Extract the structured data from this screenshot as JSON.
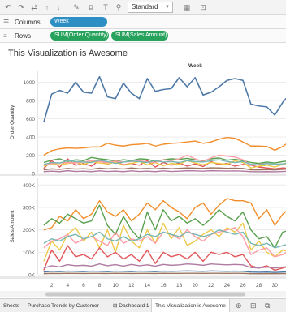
{
  "toolbar": {
    "icons": [
      "undo-icon",
      "redo-icon",
      "swap-icon",
      "sort-ascending-icon",
      "sort-descending-icon",
      "highlight-icon",
      "clip-icon",
      "label-icon",
      "pin-icon"
    ],
    "fit_value": "Standard",
    "view_icons": [
      "show-me-icon",
      "presentation-icon"
    ]
  },
  "shelves": {
    "columns": {
      "label": "Columns",
      "pills": [
        "Week"
      ]
    },
    "rows": {
      "label": "Rows",
      "pills": [
        "SUM(Order Quantity)",
        "SUM(Sales Amount)"
      ]
    }
  },
  "viz": {
    "title": "This Visualization is Awesome",
    "column_header": "Week"
  },
  "chart_data": [
    {
      "type": "line",
      "ylabel": "Order Quantity",
      "yticks": [
        0,
        200,
        400,
        600,
        800,
        1000
      ],
      "ylim": [
        0,
        1120
      ],
      "x": [
        1,
        2,
        3,
        4,
        5,
        6,
        7,
        8,
        9,
        10,
        11,
        12,
        13,
        14,
        15,
        16,
        17,
        18,
        19,
        20,
        21,
        22,
        23,
        24,
        25,
        26,
        27,
        28,
        29,
        30,
        31,
        32
      ],
      "series": [
        {
          "color": "#4e79a7",
          "values": [
            560,
            870,
            910,
            880,
            1000,
            890,
            880,
            1060,
            840,
            820,
            990,
            880,
            820,
            1040,
            900,
            920,
            930,
            1050,
            950,
            1050,
            860,
            890,
            950,
            1020,
            1040,
            1020,
            760,
            740,
            730,
            640,
            780,
            880
          ]
        },
        {
          "color": "#f28e2b",
          "values": [
            200,
            250,
            270,
            280,
            275,
            280,
            290,
            290,
            330,
            310,
            300,
            315,
            320,
            330,
            300,
            320,
            330,
            335,
            345,
            355,
            330,
            345,
            375,
            395,
            385,
            345,
            300,
            300,
            295,
            255,
            295,
            360
          ]
        },
        {
          "color": "#59a14f",
          "values": [
            120,
            145,
            160,
            130,
            150,
            140,
            175,
            160,
            150,
            135,
            150,
            140,
            160,
            155,
            130,
            150,
            160,
            155,
            165,
            150,
            140,
            160,
            170,
            145,
            155,
            140,
            120,
            110,
            125,
            115,
            130,
            140
          ]
        },
        {
          "color": "#e15759",
          "values": [
            55,
            140,
            70,
            160,
            90,
            110,
            80,
            145,
            100,
            130,
            95,
            110,
            90,
            140,
            70,
            120,
            90,
            115,
            80,
            105,
            75,
            130,
            95,
            110,
            80,
            100,
            90,
            70,
            60,
            50,
            60,
            55
          ]
        },
        {
          "color": "#edc948",
          "values": [
            80,
            105,
            95,
            110,
            120,
            100,
            130,
            115,
            105,
            125,
            90,
            110,
            130,
            95,
            120,
            85,
            110,
            100,
            140,
            115,
            95,
            120,
            110,
            100,
            140,
            120,
            60,
            80,
            90,
            70,
            100,
            90
          ]
        },
        {
          "color": "#ff9da7",
          "values": [
            90,
            110,
            115,
            120,
            115,
            125,
            140,
            130,
            120,
            135,
            125,
            130,
            140,
            125,
            120,
            150,
            140,
            160,
            200,
            160,
            130,
            170,
            200,
            190,
            180,
            150,
            90,
            100,
            110,
            95,
            105,
            120
          ]
        },
        {
          "color": "#76b7b2",
          "values": [
            100,
            120,
            115,
            140,
            130,
            125,
            120,
            145,
            130,
            110,
            125,
            135,
            130,
            120,
            140,
            125,
            130,
            120,
            140,
            130,
            125,
            140,
            150,
            130,
            120,
            130,
            100,
            95,
            110,
            100,
            105,
            120
          ]
        },
        {
          "color": "#b07aa1",
          "values": [
            20,
            25,
            20,
            30,
            22,
            25,
            20,
            28,
            22,
            25,
            20,
            28,
            22,
            25,
            20,
            28,
            22,
            25,
            30,
            28,
            25,
            30,
            28,
            26,
            28,
            25,
            20,
            18,
            20,
            18,
            22,
            25
          ]
        },
        {
          "color": "#9c755f",
          "values": [
            40,
            50,
            45,
            55,
            48,
            52,
            46,
            58,
            50,
            55,
            48,
            60,
            52,
            55,
            50,
            58,
            52,
            56,
            60,
            58,
            55,
            62,
            60,
            56,
            58,
            55,
            40,
            38,
            42,
            38,
            45,
            50
          ]
        }
      ]
    },
    {
      "type": "line",
      "ylabel": "Sales Amount",
      "yticks": [
        "0K",
        "100K",
        "200K",
        "300K",
        "400K"
      ],
      "ylim": [
        0,
        430000
      ],
      "x": [
        1,
        2,
        3,
        4,
        5,
        6,
        7,
        8,
        9,
        10,
        11,
        12,
        13,
        14,
        15,
        16,
        17,
        18,
        19,
        20,
        21,
        22,
        23,
        24,
        25,
        26,
        27,
        28,
        29,
        30,
        31,
        32
      ],
      "series": [
        {
          "color": "#f28e2b",
          "values": [
            200000,
            210000,
            260000,
            240000,
            290000,
            250000,
            270000,
            330000,
            280000,
            260000,
            290000,
            240000,
            270000,
            320000,
            290000,
            330000,
            300000,
            280000,
            250000,
            300000,
            320000,
            270000,
            310000,
            340000,
            330000,
            330000,
            320000,
            250000,
            290000,
            220000,
            270000,
            300000
          ]
        },
        {
          "color": "#59a14f",
          "values": [
            220000,
            250000,
            230000,
            270000,
            250000,
            230000,
            240000,
            310000,
            220000,
            180000,
            260000,
            200000,
            160000,
            280000,
            200000,
            290000,
            240000,
            260000,
            230000,
            250000,
            220000,
            250000,
            290000,
            260000,
            240000,
            280000,
            200000,
            160000,
            170000,
            120000,
            190000,
            200000
          ]
        },
        {
          "color": "#edc948",
          "values": [
            60000,
            150000,
            110000,
            180000,
            210000,
            150000,
            190000,
            120000,
            200000,
            100000,
            220000,
            150000,
            120000,
            200000,
            140000,
            230000,
            160000,
            210000,
            130000,
            150000,
            180000,
            200000,
            170000,
            210000,
            190000,
            230000,
            110000,
            150000,
            100000,
            80000,
            110000,
            100000
          ]
        },
        {
          "color": "#ff9da7",
          "values": [
            120000,
            150000,
            160000,
            180000,
            140000,
            160000,
            170000,
            150000,
            130000,
            190000,
            140000,
            160000,
            150000,
            170000,
            140000,
            190000,
            180000,
            160000,
            200000,
            170000,
            150000,
            180000,
            190000,
            200000,
            210000,
            170000,
            90000,
            110000,
            120000,
            80000,
            90000,
            110000
          ]
        },
        {
          "color": "#76b7b2",
          "values": [
            140000,
            160000,
            150000,
            170000,
            180000,
            160000,
            170000,
            190000,
            160000,
            150000,
            170000,
            150000,
            160000,
            180000,
            170000,
            190000,
            180000,
            170000,
            190000,
            180000,
            170000,
            180000,
            200000,
            190000,
            180000,
            190000,
            140000,
            130000,
            140000,
            120000,
            130000,
            140000
          ]
        },
        {
          "color": "#e15759",
          "values": [
            20000,
            110000,
            60000,
            130000,
            80000,
            90000,
            70000,
            120000,
            80000,
            100000,
            70000,
            90000,
            60000,
            110000,
            50000,
            100000,
            80000,
            90000,
            70000,
            100000,
            60000,
            100000,
            90000,
            100000,
            80000,
            90000,
            40000,
            30000,
            40000,
            20000,
            30000,
            40000
          ]
        },
        {
          "color": "#b07aa1",
          "values": [
            30000,
            40000,
            35000,
            45000,
            40000,
            42000,
            38000,
            48000,
            40000,
            45000,
            38000,
            46000,
            40000,
            44000,
            38000,
            46000,
            42000,
            44000,
            48000,
            46000,
            42000,
            48000,
            46000,
            44000,
            46000,
            44000,
            32000,
            30000,
            34000,
            30000,
            34000,
            36000
          ]
        },
        {
          "color": "#4e79a7",
          "values": [
            12000,
            15000,
            14000,
            16000,
            15000,
            14000,
            16000,
            15000,
            14000,
            16000,
            15000,
            14000,
            16000,
            15000,
            14000,
            16000,
            15000,
            16000,
            17000,
            16000,
            15000,
            17000,
            16000,
            15000,
            16000,
            15000,
            12000,
            11000,
            12000,
            10000,
            12000,
            13000
          ]
        },
        {
          "color": "#9c755f",
          "values": [
            5000,
            6000,
            5500,
            6500,
            6000,
            5800,
            6200,
            6000,
            5800,
            6400,
            6000,
            5800,
            6200,
            6000,
            5800,
            6400,
            6000,
            6200,
            6600,
            6400,
            6000,
            6600,
            6400,
            6200,
            6400,
            6200,
            5000,
            4800,
            5200,
            4800,
            5200,
            5400
          ]
        }
      ]
    }
  ],
  "x_axis_ticks": [
    "2",
    "4",
    "6",
    "8",
    "10",
    "12",
    "14",
    "16",
    "18",
    "20",
    "22",
    "24",
    "26",
    "28",
    "30"
  ],
  "tabs": {
    "items": [
      "Sheets",
      "Purchase Trends by Customer",
      "Dashboard 1",
      "This Visualization is Awesome"
    ],
    "icons": [
      "new-worksheet-icon",
      "new-dashboard-icon",
      "new-story-icon"
    ]
  }
}
